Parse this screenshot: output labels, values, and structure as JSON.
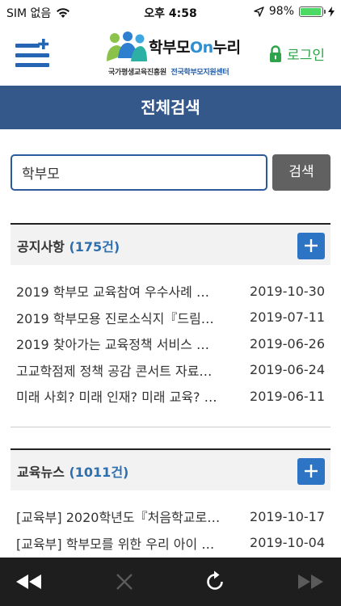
{
  "status_bar": {
    "carrier": "SIM 없음",
    "time": "오후 4:58",
    "battery": "98%",
    "battery_level": 0.98
  },
  "header": {
    "logo_title_1": "학부모",
    "logo_title_on": "On",
    "logo_title_2": "누리",
    "logo_sub_1": "국가평생교육진흥원",
    "logo_sub_2": "전국학부모지원센터",
    "login_label": "로그인"
  },
  "title_bar": {
    "title": "전체검색"
  },
  "search": {
    "value": "학부모",
    "button_label": "검색"
  },
  "sections": [
    {
      "title": "공지사항",
      "count": "(175건)",
      "items": [
        {
          "title": "2019 학부모 교육참여 우수사례 …",
          "date": "2019-10-30"
        },
        {
          "title": "2019 학부모용 진로소식지『드림…",
          "date": "2019-07-11"
        },
        {
          "title": "2019 찾아가는 교육정책 서비스 …",
          "date": "2019-06-26"
        },
        {
          "title": "고교학점제 정책 공감 콘서트 자료…",
          "date": "2019-06-24"
        },
        {
          "title": "미래 사회? 미래 인재? 미래 교육? …",
          "date": "2019-06-11"
        }
      ]
    },
    {
      "title": "교육뉴스",
      "count": "(1011건)",
      "items": [
        {
          "title": "[교육부] 2020학년도『처음학교로…",
          "date": "2019-10-17"
        },
        {
          "title": "[교육부] 학부모를 위한 우리 아이 …",
          "date": "2019-10-04"
        }
      ]
    }
  ],
  "icons": {
    "menu": "menu-plus-icon",
    "lock": "lock-icon",
    "plus": "plus-icon",
    "back": "rewind-icon",
    "stop": "close-icon",
    "reload": "reload-icon",
    "forward": "fast-forward-icon"
  },
  "colors": {
    "title_bar": "#35588a",
    "accent_blue": "#2e74c4",
    "login_green": "#2fa34a",
    "toolbar": "#1e1e1e"
  }
}
